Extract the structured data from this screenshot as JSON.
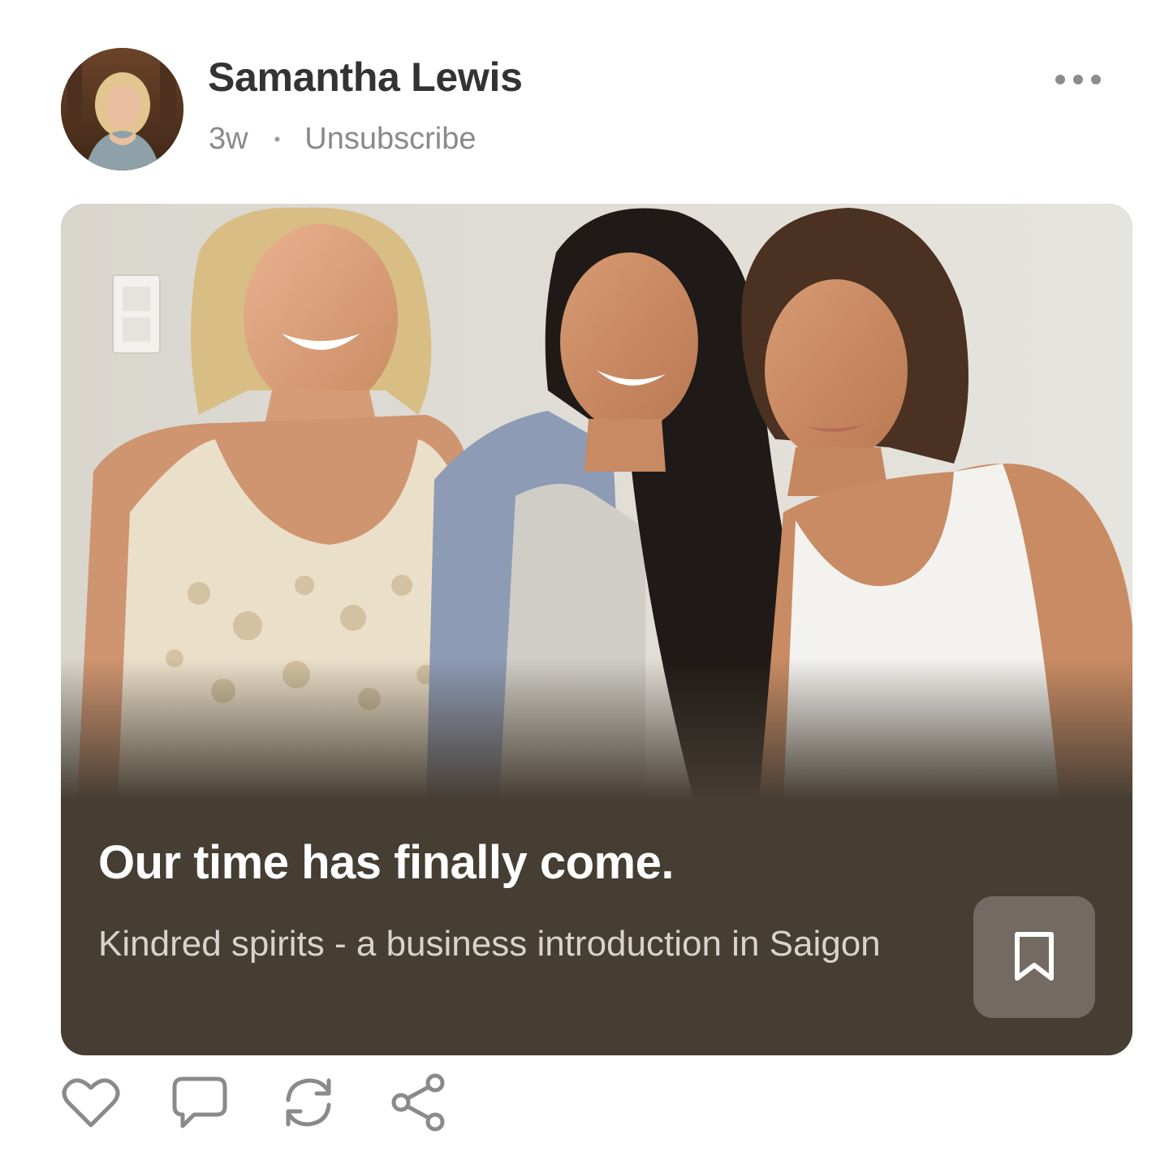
{
  "post": {
    "author": {
      "name": "Samantha Lewis",
      "avatar_icon": "avatar-photo"
    },
    "meta": {
      "age": "3w",
      "separator": "•",
      "unsubscribe_label": "Unsubscribe"
    },
    "menu_icon": "more-horizontal-icon"
  },
  "card": {
    "image_icon": "post-cover-photo",
    "title": "Our time has finally come.",
    "subtitle": "Kindred spirits - a business introduction in Saigon",
    "bookmark_icon": "bookmark-icon",
    "background_color": "#463d33",
    "bookmark_bg_color": "#736b63"
  },
  "actions": {
    "like_icon": "heart-icon",
    "comment_icon": "comment-icon",
    "restack_icon": "restack-icon",
    "share_icon": "share-icon"
  }
}
